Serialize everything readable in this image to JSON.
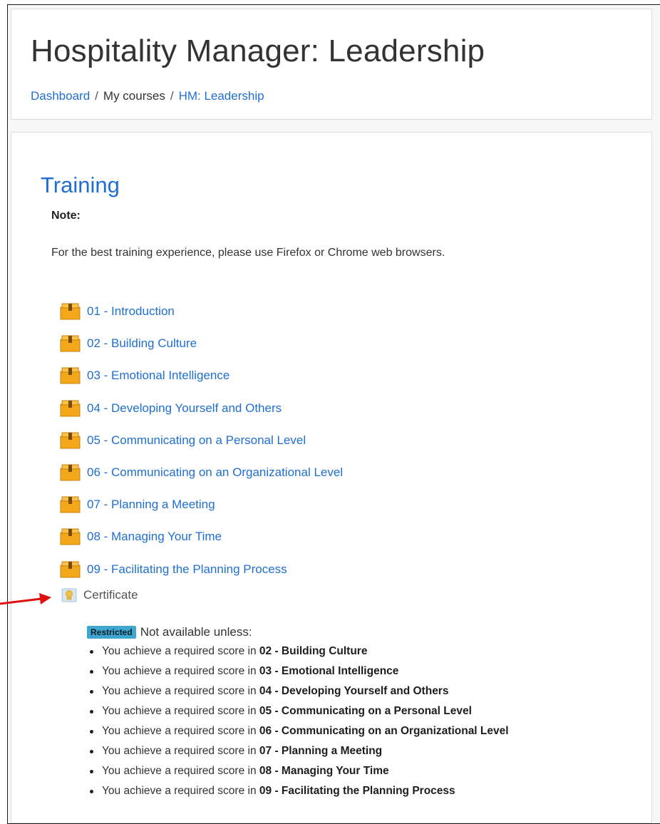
{
  "header": {
    "title": "Hospitality Manager: Leadership",
    "breadcrumb": [
      "Dashboard",
      "My courses",
      "HM: Leadership"
    ],
    "breadcrumb_separator": "/"
  },
  "section": {
    "title": "Training",
    "note_label": "Note:",
    "note_text": "For the best training experience, please use Firefox or Chrome web browsers.",
    "activities": [
      {
        "label": "01 - Introduction",
        "icon": "package-icon"
      },
      {
        "label": "02 - Building Culture",
        "icon": "package-icon"
      },
      {
        "label": "03 - Emotional Intelligence",
        "icon": "package-icon"
      },
      {
        "label": "04 - Developing Yourself and Others",
        "icon": "package-icon"
      },
      {
        "label": "05 - Communicating on a Personal Level",
        "icon": "package-icon"
      },
      {
        "label": "06 - Communicating on an Organizational Level",
        "icon": "package-icon"
      },
      {
        "label": "07 - Planning a Meeting",
        "icon": "package-icon"
      },
      {
        "label": "08 - Managing Your Time",
        "icon": "package-icon"
      },
      {
        "label": "09 - Facilitating the Planning Process",
        "icon": "package-icon"
      }
    ],
    "certificate": {
      "label": "Certificate",
      "icon": "certificate-icon",
      "restriction_badge": "Restricted",
      "restriction_text": "Not available unless:",
      "condition_prefix": "You achieve a required score in",
      "conditions": [
        "02 - Building Culture",
        "03 - Emotional Intelligence",
        "04 - Developing Yourself and Others",
        "05 - Communicating on a Personal Level",
        "06 - Communicating on an Organizational Level",
        "07 - Planning a Meeting",
        "08 - Managing Your Time",
        "09 - Facilitating the Planning Process"
      ]
    }
  },
  "colors": {
    "link": "#1f6fd1",
    "badge": "#3ea6cf",
    "arrow": "#e01010",
    "package": "#f3a81c"
  }
}
